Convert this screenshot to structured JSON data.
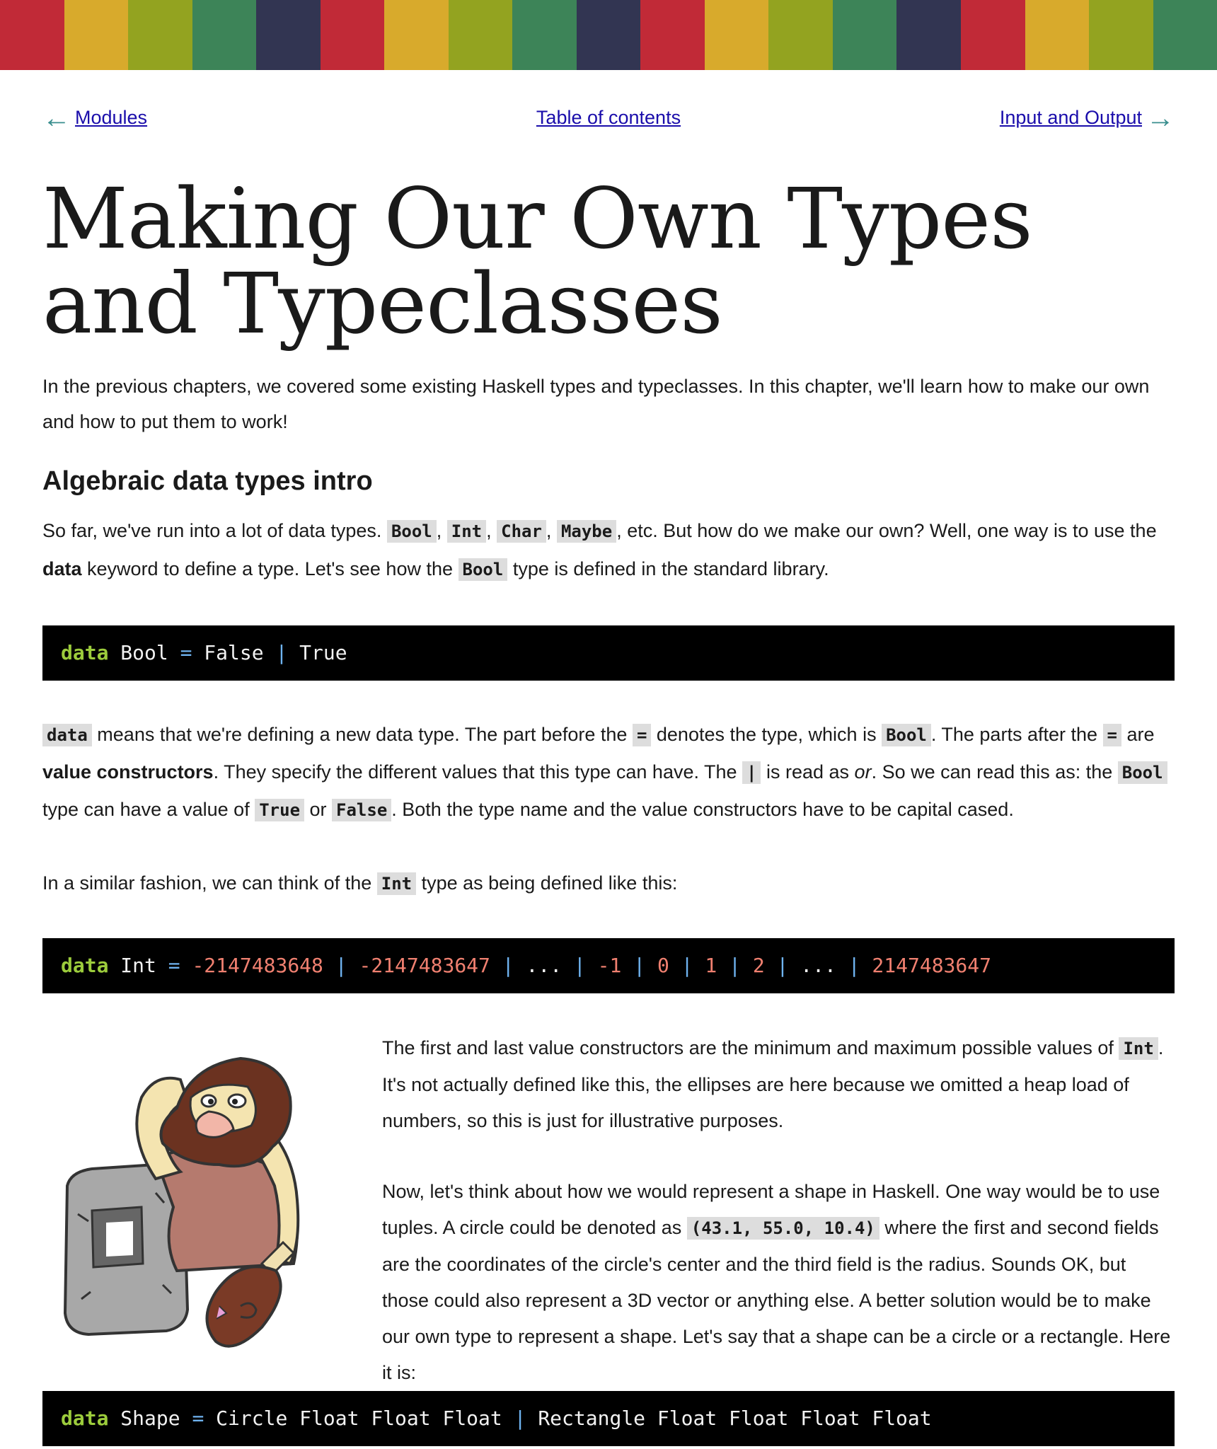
{
  "stripe_colors": [
    "#c12a37",
    "#d8aa2c",
    "#93a320",
    "#3d8458",
    "#323552",
    "#c12a37",
    "#d8aa2c",
    "#93a320",
    "#3d8458",
    "#323552",
    "#c12a37",
    "#d8aa2c",
    "#93a320",
    "#3d8458",
    "#323552",
    "#c12a37",
    "#d8aa2c",
    "#93a320",
    "#3d8458"
  ],
  "nav": {
    "prev_label": "Modules",
    "toc_label": "Table of contents",
    "next_label": "Input and Output"
  },
  "title": "Making Our Own Types and Typeclasses",
  "intro": "In the previous chapters, we covered some existing Haskell types and typeclasses. In this chapter, we'll learn how to make our own and how to put them to work!",
  "section_heading": "Algebraic data types intro",
  "p1": {
    "t1": "So far, we've run into a lot of data types. ",
    "c_bool": "Bool",
    "comma1": ", ",
    "c_int": "Int",
    "comma2": ", ",
    "c_char": "Char",
    "comma3": ", ",
    "c_maybe": "Maybe",
    "t2": ", etc. But how do we make our own? Well, one way is to use the ",
    "b_data": "data",
    "t3": " keyword to define a type. Let's see how the ",
    "c_bool2": "Bool",
    "t4": " type is defined in the standard library."
  },
  "code1": {
    "kw": "data",
    "name": " Bool ",
    "eq": "=",
    "c1": " False ",
    "bar": "|",
    "c2": " True"
  },
  "p2": {
    "c_data": "data",
    "t1": " means that we're defining a new data type. The part before the ",
    "c_eq": "=",
    "t2": " denotes the type, which is ",
    "c_bool": "Bool",
    "t3": ". The parts after the ",
    "c_eq2": "=",
    "t4": " are ",
    "b_vc": "value constructors",
    "t5": ". They specify the different values that this type can have. The ",
    "c_bar": "|",
    "t6": " is read as ",
    "i_or": "or",
    "t7": ". So we can read this as: the ",
    "c_bool2": "Bool",
    "t8": " type can have a value of ",
    "c_true": "True",
    "t9": " or ",
    "c_false": "False",
    "t10": ". Both the type name and the value constructors have to be capital cased."
  },
  "p3": {
    "t1": "In a similar fashion, we can think of the ",
    "c_int": "Int",
    "t2": " type as being defined like this:"
  },
  "code2": {
    "kw": "data",
    "name": " Int ",
    "eq": "=",
    "sp": " ",
    "n1": "-2147483648",
    "n2": "-2147483647",
    "dots": "...",
    "n3": "-1",
    "n4": "0",
    "n5": "1",
    "n6": "2",
    "n7": "2147483647",
    "bar": "|"
  },
  "p5": {
    "t1": "The first and last value constructors are the minimum and maximum possible values of ",
    "c_int": "Int",
    "t2": ". It's not actually defined like this, the ellipses are here because we omitted a heap load of numbers, so this is just for illustrative purposes."
  },
  "p6": {
    "t1": "Now, let's think about how we would represent a shape in Haskell. One way would be to use tuples. A circle could be denoted as ",
    "c_tuple": "(43.1, 55.0, 10.4)",
    "t2": " where the first and second fields are the coordinates of the circle's center and the third field is the radius. Sounds OK, but those could also represent a 3D vector or anything else. A better solution would be to make our own type to represent a shape. Let's say that a shape can be a circle or a rectangle. Here it is:"
  },
  "code3": {
    "kw": "data",
    "name": " Shape ",
    "eq": "=",
    "c1": " Circle Float Float Float ",
    "bar": "|",
    "c2": " Rectangle Float Float Float Float"
  }
}
